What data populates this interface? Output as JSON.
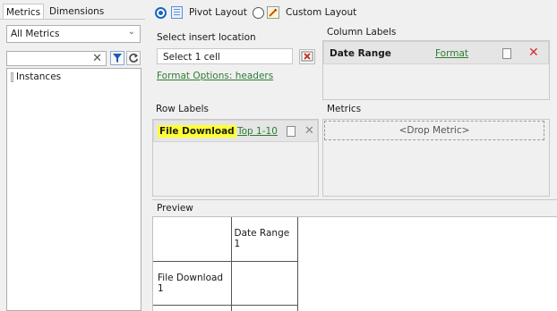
{
  "tabs": {
    "metrics": "Metrics",
    "dimensions": "Dimensions"
  },
  "left": {
    "dropdown_value": "All Metrics",
    "search_value": "",
    "tree_items": [
      "Instances"
    ]
  },
  "layout": {
    "pivot_label": "Pivot Layout",
    "custom_label": "Custom Layout"
  },
  "insert": {
    "label": "Select insert location",
    "value": "Select 1 cell",
    "format_options": "Format Options: headers"
  },
  "column_labels": {
    "title": "Column Labels",
    "item": "Date Range",
    "format_link": "Format"
  },
  "row_labels": {
    "title": "Row Labels",
    "item": "File Download",
    "top_link": "Top 1-10"
  },
  "metrics_zone": {
    "title": "Metrics",
    "drop_text": "<Drop Metric>"
  },
  "preview": {
    "title": "Preview",
    "col_header": "Date Range 1",
    "row_header": "File Download 1"
  },
  "colors": {
    "accent": "#1565c0",
    "link": "#2e7d32",
    "highlight": "#ffff33",
    "close_red": "#d32f2f"
  }
}
